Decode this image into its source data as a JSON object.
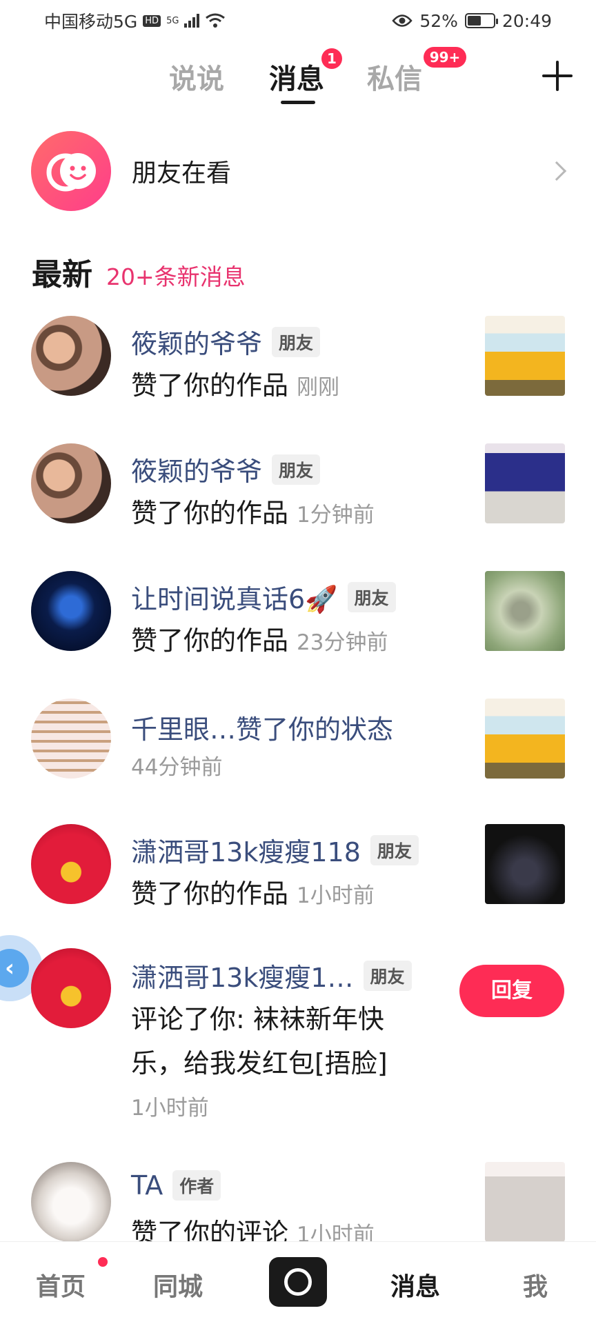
{
  "status_bar": {
    "carrier": "中国移动5G",
    "hd": "HD",
    "network": "5G",
    "battery": "52%",
    "battery_level": 0.52,
    "time": "20:49"
  },
  "tabs": [
    {
      "label": "说说",
      "active": false
    },
    {
      "label": "消息",
      "active": true,
      "badge": "1"
    },
    {
      "label": "私信",
      "active": false,
      "badge": "99+"
    }
  ],
  "friends_watching": {
    "label": "朋友在看"
  },
  "section": {
    "title": "最新",
    "subtitle": "20+条新消息"
  },
  "notifications": [
    {
      "name": "筱颖的爷爷",
      "tag": "朋友",
      "action": "赞了你的作品",
      "time": "刚刚"
    },
    {
      "name": "筱颖的爷爷",
      "tag": "朋友",
      "action": "赞了你的作品",
      "time": "1分钟前"
    },
    {
      "name": "让时间说真话6🚀",
      "tag": "朋友",
      "action": "赞了你的作品",
      "time": "23分钟前"
    },
    {
      "name": "千里眼…赞了你的状态",
      "time": "44分钟前"
    },
    {
      "name": "潇洒哥13k瘦瘦118",
      "tag": "朋友",
      "action": "赞了你的作品",
      "time": "1小时前"
    },
    {
      "name": "潇洒哥13k瘦瘦1…",
      "tag": "朋友",
      "comment_line1": "评论了你: 袜袜新年快",
      "comment_line2": "乐，给我发红包[捂脸]",
      "time": "1小时前",
      "reply_label": "回复"
    },
    {
      "name": "TA",
      "tag": "作者",
      "action": "赞了你的评论",
      "time": "1小时前"
    }
  ],
  "bottom_nav": [
    {
      "label": "首页",
      "active": false,
      "dot": true
    },
    {
      "label": "同城",
      "active": false
    },
    {
      "label": "消息",
      "active": true
    },
    {
      "label": "我",
      "active": false
    }
  ],
  "colors": {
    "accent": "#fe2c55",
    "name": "#3a4d7c",
    "subtitle": "#e8336e"
  }
}
